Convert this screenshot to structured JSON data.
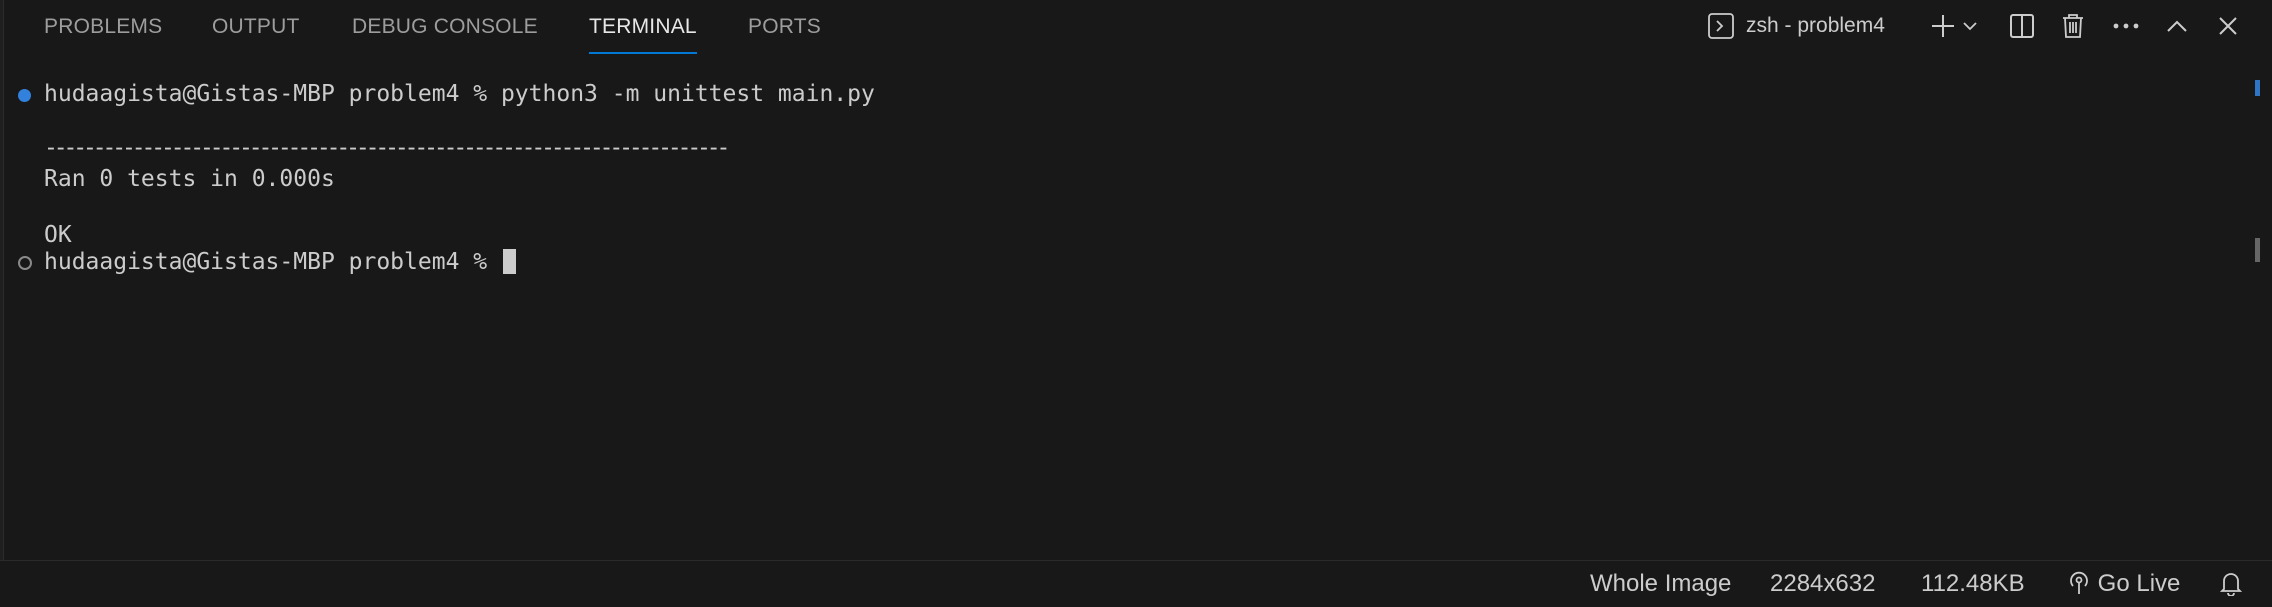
{
  "tabs": [
    {
      "label": "PROBLEMS"
    },
    {
      "label": "OUTPUT"
    },
    {
      "label": "DEBUG CONSOLE"
    },
    {
      "label": "TERMINAL",
      "active": true
    },
    {
      "label": "PORTS"
    }
  ],
  "toolbar": {
    "terminal_name": "zsh - problem4",
    "icons": [
      "terminal-icon",
      "plus-icon",
      "chevron-down-icon",
      "split-icon",
      "trash-icon",
      "more-icon",
      "chevron-up-icon",
      "close-icon"
    ]
  },
  "terminal": {
    "lines": [
      "hudaagista@Gistas-MBP problem4 % python3 -m unittest main.py",
      "",
      "----------------------------------------------------------------------",
      "Ran 0 tests in 0.000s",
      "",
      "OK",
      "hudaagista@Gistas-MBP problem4 % "
    ]
  },
  "statusbar": {
    "whole_image": "Whole Image",
    "dimensions": "2284x632",
    "file_size": "112.48KB",
    "go_live": "Go Live"
  },
  "colors": {
    "background": "#181818",
    "accent": "#0078d4",
    "text": "#cccccc",
    "muted": "#9d9d9d"
  }
}
